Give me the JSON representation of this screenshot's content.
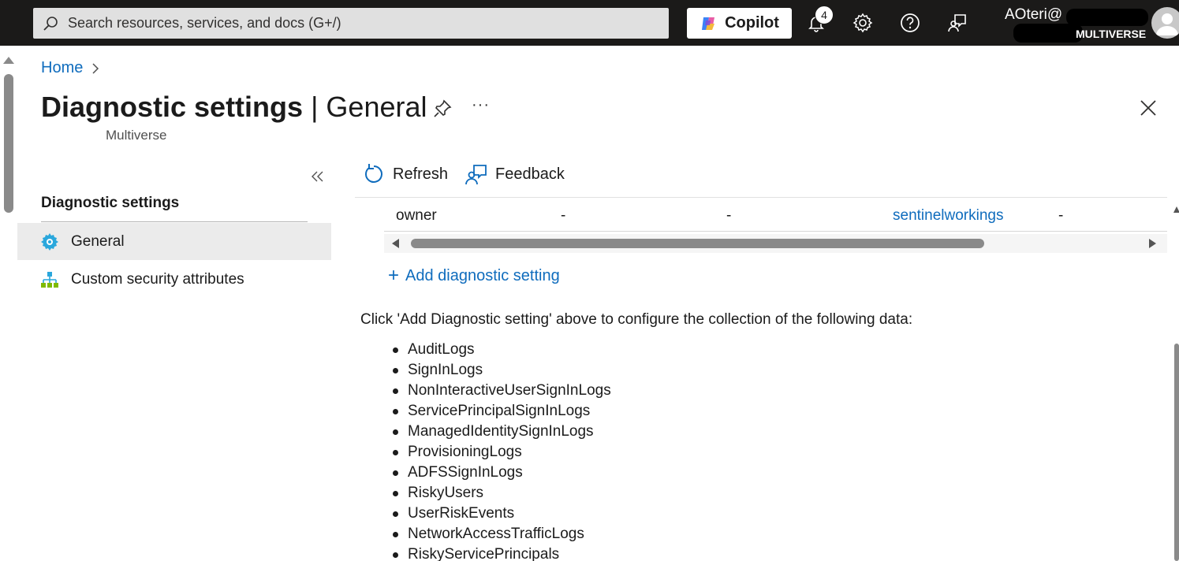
{
  "topbar": {
    "search_placeholder": "Search resources, services, and docs (G+/)",
    "copilot_label": "Copilot",
    "notification_count": "4",
    "account_name": "AOteri@",
    "account_org": "MULTIVERSE"
  },
  "breadcrumb": {
    "home": "Home"
  },
  "header": {
    "title_bold": "Diagnostic settings",
    "title_rest": " | General",
    "subtitle": "Multiverse",
    "more_label": "···"
  },
  "nav": {
    "heading": "Diagnostic settings",
    "items": [
      {
        "label": "General",
        "icon": "gear-icon",
        "selected": true
      },
      {
        "label": "Custom security attributes",
        "icon": "hierarchy-icon",
        "selected": false
      }
    ]
  },
  "toolbar": {
    "refresh_label": "Refresh",
    "feedback_label": "Feedback"
  },
  "table": {
    "row": [
      "owner",
      "-",
      "-",
      "sentinelworkings",
      "-"
    ]
  },
  "add_setting_label": "Add diagnostic setting",
  "info_text": "Click 'Add Diagnostic setting' above to configure the collection of the following data:",
  "log_types": [
    "AuditLogs",
    "SignInLogs",
    "NonInteractiveUserSignInLogs",
    "ServicePrincipalSignInLogs",
    "ManagedIdentitySignInLogs",
    "ProvisioningLogs",
    "ADFSSignInLogs",
    "RiskyUsers",
    "UserRiskEvents",
    "NetworkAccessTrafficLogs",
    "RiskyServicePrincipals"
  ],
  "colors": {
    "topbar": "#1b1a19",
    "link": "#0f6cbd",
    "selected_nav": "#ebebeb",
    "gear_icon": "#2aa7dc"
  }
}
